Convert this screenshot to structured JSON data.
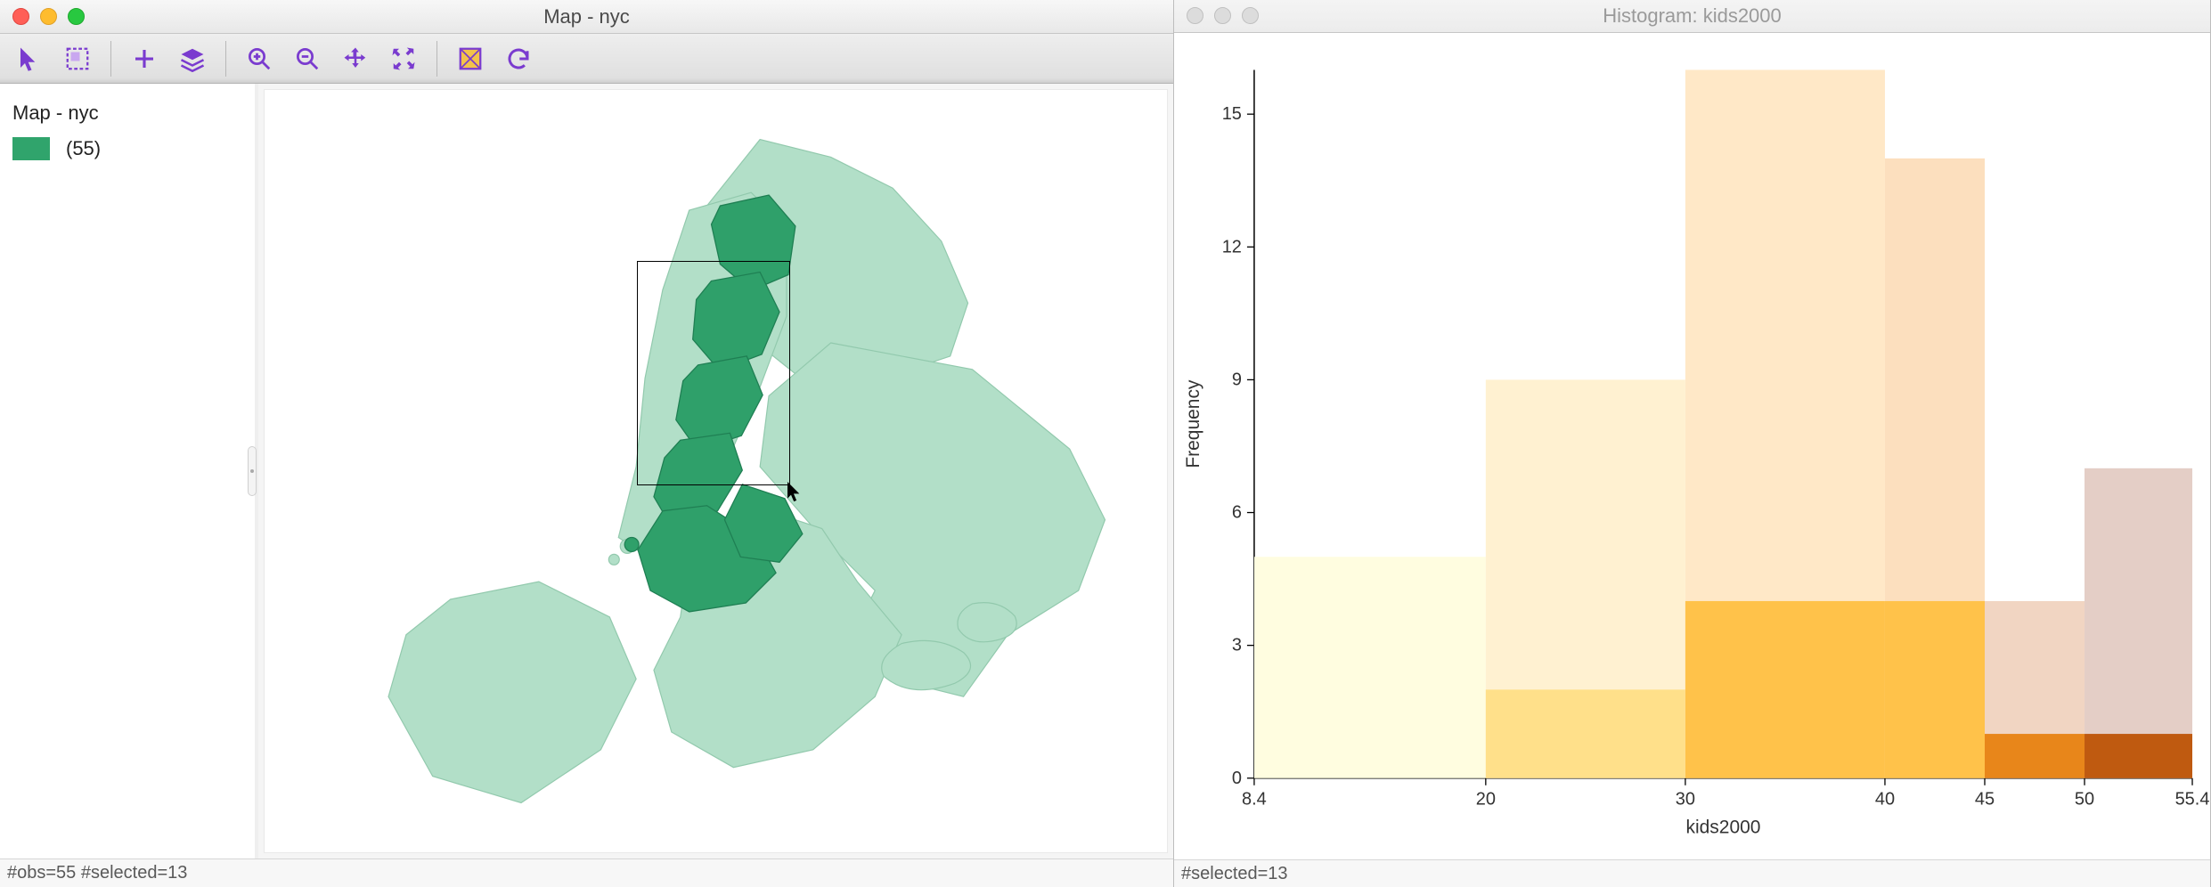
{
  "map_window": {
    "title": "Map - nyc",
    "legend_title": "Map - nyc",
    "legend_count_label": "(55)",
    "status": "#obs=55 #selected=13",
    "toolbar_icons": [
      "pointer-icon",
      "select-rect-icon",
      "add-icon",
      "layers-icon",
      "zoom-in-icon",
      "zoom-out-icon",
      "pan-icon",
      "zoom-extent-icon",
      "brush-rect-icon",
      "refresh-icon"
    ],
    "legend_color": "#30a46c",
    "map_unselected_color": "#b2dfc8",
    "map_selected_color": "#2fa06a"
  },
  "hist_window": {
    "title": "Histogram: kids2000",
    "status": "#selected=13"
  },
  "chart_data": {
    "type": "bar",
    "title": "Histogram: kids2000",
    "xlabel": "kids2000",
    "ylabel": "Frequency",
    "ylim": [
      0,
      16
    ],
    "yticks": [
      0,
      3,
      6,
      9,
      12,
      15
    ],
    "bin_edges": [
      8.4,
      20,
      30,
      40,
      45,
      50,
      55.4
    ],
    "xtick_labels": [
      "8.4",
      "20",
      "30",
      "40",
      "45",
      "50",
      "55.4"
    ],
    "series": [
      {
        "name": "total",
        "values": [
          5,
          9,
          16,
          14,
          4,
          7
        ],
        "colors": [
          "#fffde0",
          "#fff1d1",
          "#ffe8c7",
          "#fcdfbe",
          "#f1d5c2",
          "#e4cec6"
        ]
      },
      {
        "name": "selected",
        "values": [
          0,
          2,
          4,
          4,
          1,
          1
        ],
        "colors": [
          "#fff59a",
          "#ffe08a",
          "#ffc24a",
          "#ffc24a",
          "#e8861a",
          "#bf5a10"
        ]
      }
    ]
  }
}
